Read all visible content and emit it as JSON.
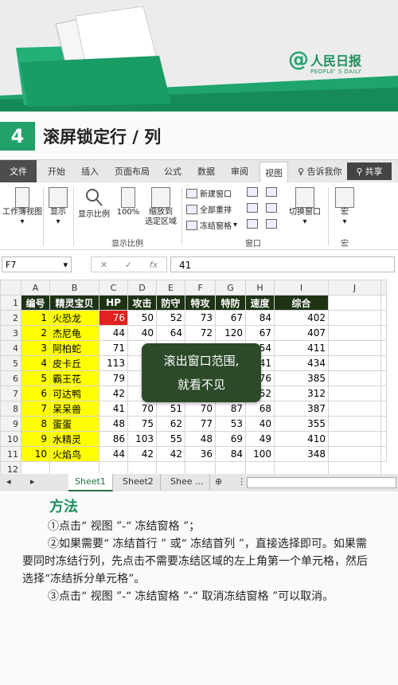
{
  "brand": {
    "logo_symbol": "@",
    "logo_cn": "人民日报",
    "logo_en": "PEOPLE' S DAILY",
    "color": "#1fa46e"
  },
  "section": {
    "number": "4",
    "title": "滚屏锁定行 / 列"
  },
  "ribbon": {
    "tabs": [
      "文件",
      "开始",
      "插入",
      "页面布局",
      "公式",
      "数据",
      "审阅",
      "视图"
    ],
    "active_tab": "视图",
    "tell_me": "告诉我你",
    "share": "共享",
    "buttons": {
      "workbook_views": "工作簿视图",
      "show": "显示",
      "zoom": "显示比例",
      "zoom100": "100%",
      "zoom_selection_1": "缩放到",
      "zoom_selection_2": "选定区域",
      "new_window": "新建窗口",
      "arrange_all": "全部重排",
      "freeze_panes": "冻结窗格",
      "switch_windows": "切换窗口",
      "macros": "宏"
    },
    "groups": {
      "zoom": "显示比例",
      "window": "窗口",
      "macros": "宏"
    }
  },
  "formula_bar": {
    "name_box": "F7",
    "fx": "fx",
    "value": "41"
  },
  "grid": {
    "col_headers": [
      "A",
      "B",
      "C",
      "D",
      "E",
      "F",
      "G",
      "H",
      "I",
      "J"
    ],
    "header_row": [
      "编号",
      "精灵宝贝",
      "HP",
      "攻击",
      "防守",
      "特攻",
      "特防",
      "速度",
      "综合"
    ],
    "rows": [
      [
        "1",
        "火恐龙",
        "76",
        "50",
        "52",
        "73",
        "67",
        "84",
        "402"
      ],
      [
        "2",
        "杰尼龟",
        "44",
        "40",
        "64",
        "72",
        "120",
        "67",
        "407"
      ],
      [
        "3",
        "阿柏蛇",
        "71",
        "",
        "",
        "",
        "",
        "54",
        "411"
      ],
      [
        "4",
        "皮卡丘",
        "113",
        "",
        "",
        "",
        "",
        "41",
        "434"
      ],
      [
        "5",
        "霸王花",
        "79",
        "",
        "",
        "",
        "",
        "76",
        "385"
      ],
      [
        "6",
        "可达鸭",
        "42",
        "",
        "",
        "",
        "",
        "52",
        "312"
      ],
      [
        "7",
        "呆呆兽",
        "41",
        "70",
        "51",
        "70",
        "87",
        "68",
        "387"
      ],
      [
        "8",
        "蛋蛋",
        "48",
        "75",
        "62",
        "77",
        "53",
        "40",
        "355"
      ],
      [
        "9",
        "水精灵",
        "86",
        "103",
        "55",
        "48",
        "69",
        "49",
        "410"
      ],
      [
        "10",
        "火焰鸟",
        "44",
        "42",
        "42",
        "36",
        "84",
        "100",
        "348"
      ]
    ],
    "partial_row_num": "12",
    "highlight_color": "#e2221f",
    "header_color": "#1e3314"
  },
  "callout": {
    "line1": "滚出窗口范围,",
    "line2": "就看不见"
  },
  "sheets": [
    "Sheet1",
    "Sheet2",
    "Shee ..."
  ],
  "method": {
    "title": "方法",
    "p1": "①点击“ 视图 ”-“ 冻结窗格 ”；",
    "p2": "②如果需要“ 冻结首行 ” 或“ 冻结首列 ”，直接选择即可。如果需要同时冻结行列，先点击不需要冻结区域的左上角第一个单元格，然后选择“冻结拆分单元格”。",
    "p3": "③点击“ 视图 ”-“ 冻结窗格 ”-“ 取消冻结窗格 ”可以取消。"
  }
}
